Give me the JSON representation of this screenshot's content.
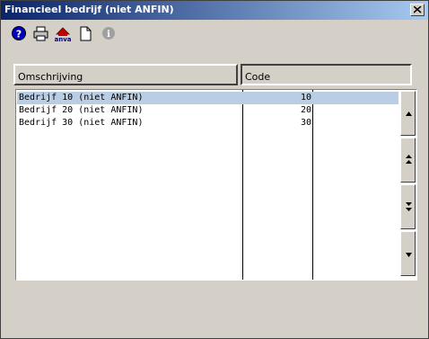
{
  "window": {
    "title": "Financieel bedrijf (niet ANFIN)"
  },
  "toolbar": {
    "buttons": [
      {
        "icon": "help-icon"
      },
      {
        "icon": "print-icon"
      },
      {
        "icon": "anva-icon",
        "label": "anva"
      },
      {
        "icon": "new-document-icon"
      },
      {
        "icon": "info-icon"
      }
    ]
  },
  "table": {
    "columns": [
      "Omschrijving",
      "Code"
    ],
    "rows": [
      {
        "description": "Bedrijf 10 (niet ANFIN)",
        "code": "10",
        "selected": true
      },
      {
        "description": "Bedrijf 20 (niet ANFIN)",
        "code": "20",
        "selected": false
      },
      {
        "description": "Bedrijf 30 (niet ANFIN)",
        "code": "30",
        "selected": false
      }
    ]
  },
  "scroll_buttons": [
    "scroll-up",
    "page-up",
    "page-down",
    "scroll-down"
  ],
  "colors": {
    "title_start": "#0a246a",
    "title_end": "#a6caf0",
    "selection": "#b9cde5",
    "face": "#d4d0c8"
  }
}
